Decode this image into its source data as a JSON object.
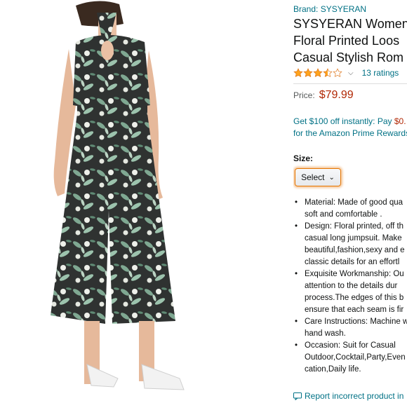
{
  "product": {
    "brand": "Brand: SYSYERAN",
    "title_lines": [
      "SYSYERAN Women",
      "Floral Printed Loos",
      "Casual Stylish Rom"
    ],
    "rating": {
      "stars": 3.5,
      "icon": "star-rating-icon",
      "chevron": "chevron-down-icon",
      "ratings_link": "13 ratings"
    },
    "price": {
      "label": "Price:",
      "value": "$79.99"
    },
    "promo_lines": [
      {
        "text": "Get $100 off instantly: Pay ",
        "amount": "$0."
      },
      {
        "text": "for the Amazon Prime Rewards",
        "amount": ""
      }
    ],
    "size": {
      "label": "Size:",
      "select_value": "Select"
    },
    "bullets": [
      [
        "Material: Made of good qua",
        "soft and comfortable ."
      ],
      [
        "Design: Floral printed, off th",
        "casual long jumpsuit. Make",
        "beautiful,fashion,sexy and e",
        "classic details for an effortl"
      ],
      [
        "Exquisite Workmanship: Ou",
        "attention to the details dur",
        "process.The edges of this b",
        "ensure that each seam is fir"
      ],
      [
        "Care Instructions: Machine w",
        "hand wash."
      ],
      [
        "Occasion: Suit for Casual",
        "Outdoor,Cocktail,Party,Even",
        "cation,Daily life."
      ]
    ],
    "report_link": "Report incorrect product in"
  },
  "colors": {
    "link": "#007185",
    "price": "#b12704",
    "star": "#ffa41c",
    "select_focus": "#e77600"
  }
}
